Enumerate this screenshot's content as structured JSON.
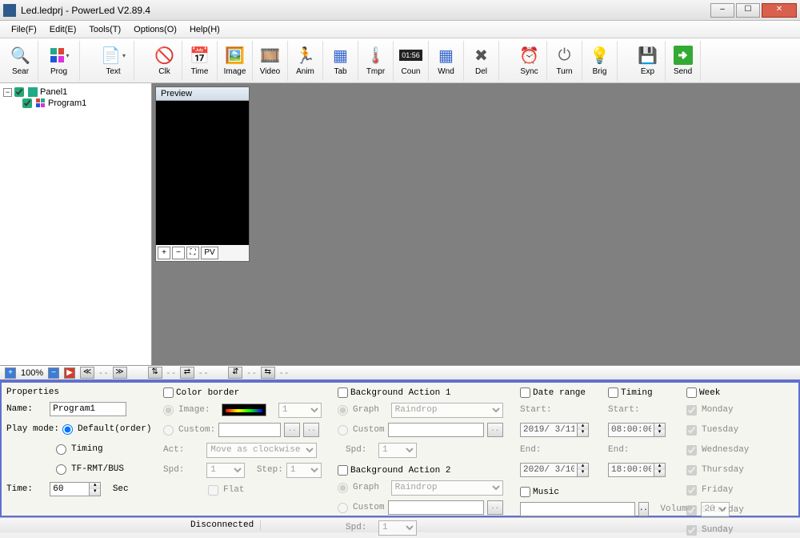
{
  "window": {
    "title": "Led.ledprj - PowerLed V2.89.4"
  },
  "menu": {
    "file": "File(F)",
    "edit": "Edit(E)",
    "tools": "Tools(T)",
    "options": "Options(O)",
    "help": "Help(H)"
  },
  "toolbar": {
    "sear": "Sear",
    "prog": "Prog",
    "text": "Text",
    "clk": "Clk",
    "time": "Time",
    "image": "Image",
    "video": "Video",
    "anim": "Anim",
    "tab": "Tab",
    "tmpr": "Tmpr",
    "coun": "Coun",
    "wnd": "Wnd",
    "del": "Del",
    "sync": "Sync",
    "turn": "Turn",
    "brig": "Brig",
    "exp": "Exp",
    "send": "Send"
  },
  "tree": {
    "panel1": "Panel1",
    "program1": "Program1"
  },
  "preview": {
    "title": "Preview",
    "plus": "+",
    "minus": "−",
    "fit": "⛶",
    "pv": "PV"
  },
  "zoom": {
    "pct": "100%",
    "dashes": "- -"
  },
  "props": {
    "title": "Properties",
    "name_lbl": "Name:",
    "name_val": "Program1",
    "playmode_lbl": "Play mode:",
    "pm_default": "Default(order)",
    "pm_timing": "Timing",
    "pm_tf": "TF-RMT/BUS",
    "time_lbl": "Time:",
    "time_val": "60",
    "time_unit": "Sec"
  },
  "color": {
    "title": "Color border",
    "image": "Image:",
    "image_num": "1",
    "custom": "Custom:",
    "act": "Act:",
    "act_val": "Move as clockwise",
    "spd": "Spd:",
    "spd_val": "1",
    "step": "Step:",
    "step_val": "1",
    "flat": "Flat"
  },
  "bg1": {
    "title": "Background Action 1",
    "graph": "Graph",
    "graph_val": "Raindrop",
    "custom": "Custom",
    "spd": "Spd:",
    "spd_val": "1"
  },
  "bg2": {
    "title": "Background Action 2",
    "graph": "Graph",
    "graph_val": "Raindrop",
    "custom": "Custom",
    "spd": "Spd:",
    "spd_val": "1"
  },
  "date": {
    "title": "Date range",
    "start": "Start:",
    "start_val": "2019/ 3/11",
    "end": "End:",
    "end_val": "2020/ 3/10"
  },
  "timing": {
    "title": "Timing",
    "start": "Start:",
    "start_val": "08:00:00",
    "end": "End:",
    "end_val": "18:00:00"
  },
  "music": {
    "title": "Music",
    "vol": "Volume:",
    "vol_val": "20"
  },
  "week": {
    "title": "Week",
    "mon": "Monday",
    "tue": "Tuesday",
    "wed": "Wednesday",
    "thu": "Thursday",
    "fri": "Friday",
    "sat": "Saturday",
    "sun": "Sunday"
  },
  "status": {
    "disconnected": "Disconnected"
  }
}
